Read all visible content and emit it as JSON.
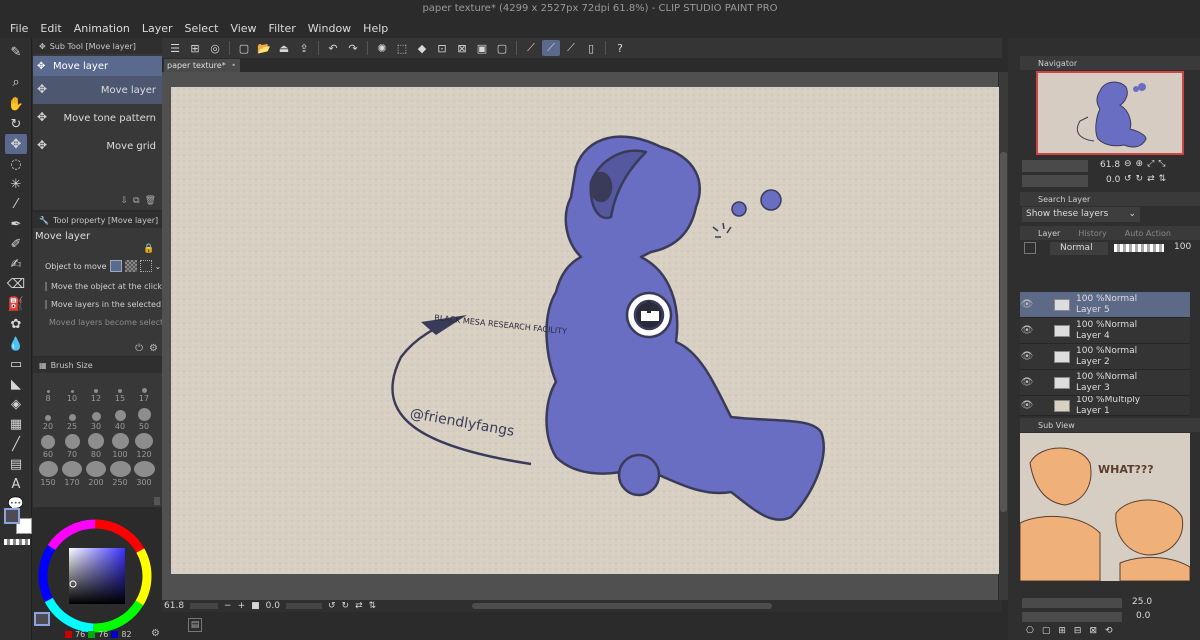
{
  "window": {
    "title": "paper texture* (4299 x 2527px 72dpi 61.8%)  -  CLIP STUDIO PAINT PRO"
  },
  "menu": [
    "File",
    "Edit",
    "Animation",
    "Layer",
    "Select",
    "View",
    "Filter",
    "Window",
    "Help"
  ],
  "subtool_panel": {
    "title": "Sub Tool [Move layer]",
    "group": "Move layer",
    "items": [
      "Move layer",
      "Move tone pattern",
      "Move grid"
    ]
  },
  "tool_property": {
    "title": "Tool property [Move layer]",
    "tool_name": "Move layer",
    "object_to_move_label": "Object to move",
    "options": [
      "Move the object at the clicked",
      "Move layers in the selected are",
      "Moved layers become selected"
    ]
  },
  "brush_size": {
    "title": "Brush Size",
    "sizes": [
      "8",
      "10",
      "12",
      "15",
      "17",
      "20",
      "25",
      "30",
      "40",
      "50",
      "60",
      "70",
      "80",
      "100",
      "120",
      "150",
      "170",
      "200",
      "250",
      "300"
    ]
  },
  "color": {
    "r": "76",
    "g": "76",
    "b": "82",
    "main_color": "#4c4c52"
  },
  "document": {
    "tab": "paper texture*",
    "zoom": "61.8",
    "angle": "0.0",
    "artwork_text": {
      "shirt": "BLACK MESA RESEARCH FACILITY",
      "signature": "@friendlyfangs"
    }
  },
  "navigator": {
    "title": "Navigator",
    "zoom": "61.8",
    "angle": "0.0"
  },
  "search_layer": {
    "title": "Search Layer",
    "filter": "Show these layers"
  },
  "layer_panel": {
    "tabs": [
      "Layer",
      "History",
      "Auto Action"
    ],
    "blend_mode": "Normal",
    "opacity": "100",
    "layers": [
      {
        "opacity": "100 %",
        "mode": "Normal",
        "name": "Layer 5",
        "selected": true
      },
      {
        "opacity": "100 %",
        "mode": "Normal",
        "name": "Layer 4",
        "selected": false
      },
      {
        "opacity": "100 %",
        "mode": "Normal",
        "name": "Layer 2",
        "selected": false
      },
      {
        "opacity": "100 %",
        "mode": "Normal",
        "name": "Layer 3",
        "selected": false
      },
      {
        "opacity": "100 %",
        "mode": "Multiply",
        "name": "Layer 1",
        "selected": false
      }
    ]
  },
  "sub_view": {
    "title": "Sub View",
    "zoom": "25.0",
    "angle": "0.0",
    "reference_text": "WHAT???"
  },
  "accent": "#5a6a8f",
  "figure_color": "#6a6ec2"
}
